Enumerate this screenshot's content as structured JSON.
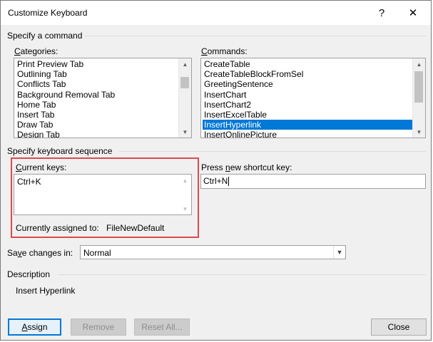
{
  "window": {
    "title": "Customize Keyboard",
    "help_glyph": "?",
    "close_glyph": "✕"
  },
  "specify_command": {
    "heading": "Specify a command",
    "categories": {
      "label_u": "C",
      "label_rest": "ategories:",
      "items": [
        "Print Preview Tab",
        "Outlining Tab",
        "Conflicts Tab",
        "Background Removal Tab",
        "Home Tab",
        "Insert Tab",
        "Draw Tab",
        "Design Tab"
      ]
    },
    "commands": {
      "label_u": "C",
      "label_rest": "ommands:",
      "items": [
        "CreateTable",
        "CreateTableBlockFromSel",
        "GreetingSentence",
        "InsertChart",
        "InsertChart2",
        "InsertExcelTable",
        "InsertHyperlink",
        "InsertOnlinePicture"
      ],
      "selected": "InsertHyperlink"
    }
  },
  "keyboard_sequence": {
    "heading": "Specify keyboard sequence",
    "current_keys": {
      "label_u": "C",
      "label_rest": "urrent keys:",
      "items": [
        "Ctrl+K"
      ]
    },
    "new_shortcut": {
      "label_pre": "Press ",
      "label_u": "n",
      "label_rest": "ew shortcut key:",
      "value": "Ctrl+N"
    },
    "assigned": {
      "label": "Currently assigned to:",
      "value": "FileNewDefault"
    }
  },
  "save_changes": {
    "label_pre": "Sa",
    "label_u": "v",
    "label_rest": "e changes in:",
    "value": "Normal"
  },
  "description": {
    "heading": "Description",
    "text": "Insert Hyperlink"
  },
  "buttons": {
    "assign_u": "A",
    "assign_rest": "ssign",
    "remove": "Remove",
    "reset_all": "Reset All...",
    "close": "Close"
  }
}
